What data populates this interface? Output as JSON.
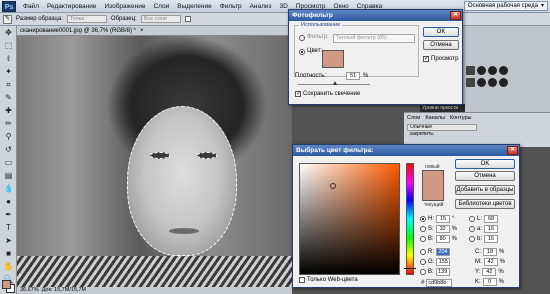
{
  "menubar": {
    "logo": "Ps",
    "items": [
      "Файл",
      "Редактирование",
      "Изображение",
      "Слои",
      "Выделение",
      "Фильтр",
      "Анализ",
      "3D",
      "Просмотр",
      "Окно",
      "Справка"
    ],
    "workspace": "Основная рабочая среда"
  },
  "options": {
    "sample_size_label": "Размер образца:",
    "sample_size_value": "Точка",
    "samples_label": "Образец:",
    "samples_value": "Все слои"
  },
  "document": {
    "tab": "сканирование0001.jpg @ 36,7% (RGB/8) *",
    "status_zoom": "36,67%",
    "status_doc": "Док: 15,7M/15,7M"
  },
  "layers": {
    "label": "Уровни яркости",
    "tabs": [
      "Слои",
      "Каналы",
      "Контуры"
    ],
    "blend": "Обычные",
    "lock": "Закрепить:"
  },
  "photo_filter": {
    "title": "Фотофильтр",
    "group_label": "Использование",
    "filter_label": "Фильтр:",
    "filter_value": "Теплый фильтр (85)",
    "color_label": "Цвет:",
    "density_label": "Плотность:",
    "density_value": "51",
    "density_unit": "%",
    "density_fraction": 0.51,
    "preserve_label": "Сохранить свечение",
    "ok": "OK",
    "cancel": "Отмена",
    "preview": "Просмотр",
    "swatch_color": "#d09a84"
  },
  "color_picker": {
    "title": "Выбрать цвет фильтра:",
    "new_label": "новый",
    "current_label": "текущий",
    "ok": "OK",
    "cancel": "Отмена",
    "add_swatch": "Добавить в образцы",
    "libraries": "Библиотеки цветов",
    "hsb": [
      {
        "label": "H:",
        "value": "15",
        "unit": "°"
      },
      {
        "label": "S:",
        "value": "32",
        "unit": "%"
      },
      {
        "label": "B:",
        "value": "80",
        "unit": "%"
      }
    ],
    "rgb": [
      {
        "label": "R:",
        "value": "204"
      },
      {
        "label": "G:",
        "value": "155"
      },
      {
        "label": "B:",
        "value": "139"
      }
    ],
    "lab": [
      {
        "label": "L:",
        "value": "68"
      },
      {
        "label": "a:",
        "value": "16"
      },
      {
        "label": "b:",
        "value": "16"
      }
    ],
    "cmyk": [
      {
        "label": "C:",
        "value": "18",
        "unit": "%"
      },
      {
        "label": "M:",
        "value": "42",
        "unit": "%"
      },
      {
        "label": "Y:",
        "value": "42",
        "unit": "%"
      },
      {
        "label": "K:",
        "value": "0",
        "unit": "%"
      }
    ],
    "hex_label": "#",
    "hex": "cd9b8b",
    "web_only": "Только Web-цвета",
    "color": "#d09a84"
  }
}
